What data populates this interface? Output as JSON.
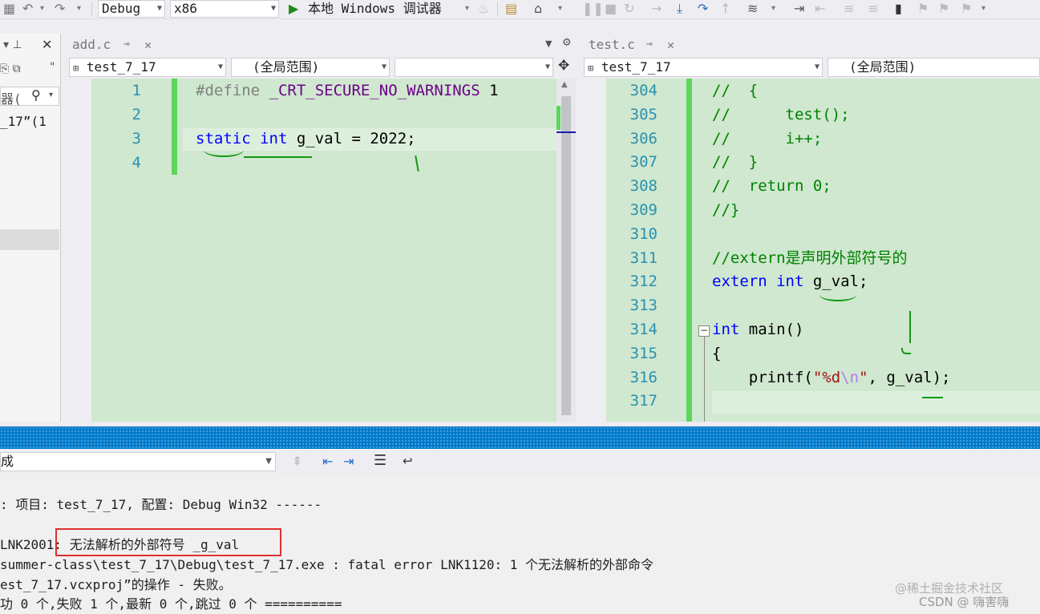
{
  "toolbar": {
    "config": "Debug",
    "platform": "x86",
    "run_label": "本地 Windows 调试器"
  },
  "left_panel": {
    "search_text": "器(",
    "item_text": "_17”(1"
  },
  "editor_left": {
    "tab_label": "add.c",
    "nav_project": "test_7_17",
    "nav_scope": "(全局范围)",
    "lines": [
      {
        "n": "1",
        "code": "#define _CRT_SECURE_NO_WARNINGS 1"
      },
      {
        "n": "2",
        "code": ""
      },
      {
        "n": "3",
        "code": "static int g_val = 2022;"
      },
      {
        "n": "4",
        "code": ""
      }
    ]
  },
  "editor_right": {
    "tab_label": "test.c",
    "nav_project": "test_7_17",
    "nav_scope": "(全局范围)",
    "lines": [
      {
        "n": "304",
        "code": "//  {"
      },
      {
        "n": "305",
        "code": "//      test();"
      },
      {
        "n": "306",
        "code": "//      i++;"
      },
      {
        "n": "307",
        "code": "//  }"
      },
      {
        "n": "308",
        "code": "//  return 0;"
      },
      {
        "n": "309",
        "code": "//}"
      },
      {
        "n": "310",
        "code": ""
      },
      {
        "n": "311",
        "code": "//extern是声明外部符号的"
      },
      {
        "n": "312",
        "code": "extern int g_val;"
      },
      {
        "n": "313",
        "code": ""
      },
      {
        "n": "314",
        "code": "int main()"
      },
      {
        "n": "315",
        "code": "{"
      },
      {
        "n": "316",
        "code": "    printf(\"%d\\n\", g_val);"
      },
      {
        "n": "317",
        "code": ""
      }
    ]
  },
  "output": {
    "source": "成",
    "lines": [
      ": 项目: test_7_17, 配置: Debug Win32 ------",
      "",
      "LNK2001: 无法解析的外部符号 _g_val",
      "summer-class\\test_7_17\\Debug\\test_7_17.exe : fatal error LNK1120: 1 个无法解析的外部命令",
      "est_7_17.vcxproj”的操作 - 失败。",
      "功 0 个,失败 1 个,最新 0 个,跳过 0 个 =========="
    ]
  },
  "watermark": {
    "line1": "@稀土掘金技术社区",
    "line2": "CSDN @ 嗨害嗨"
  },
  "colors": {
    "editor_bg": "#cfe8cf",
    "change_bar": "#5bd75b",
    "keyword": "#0000ff",
    "comment": "#008000",
    "output_title": "#007acc",
    "error_box": "#e03030"
  }
}
